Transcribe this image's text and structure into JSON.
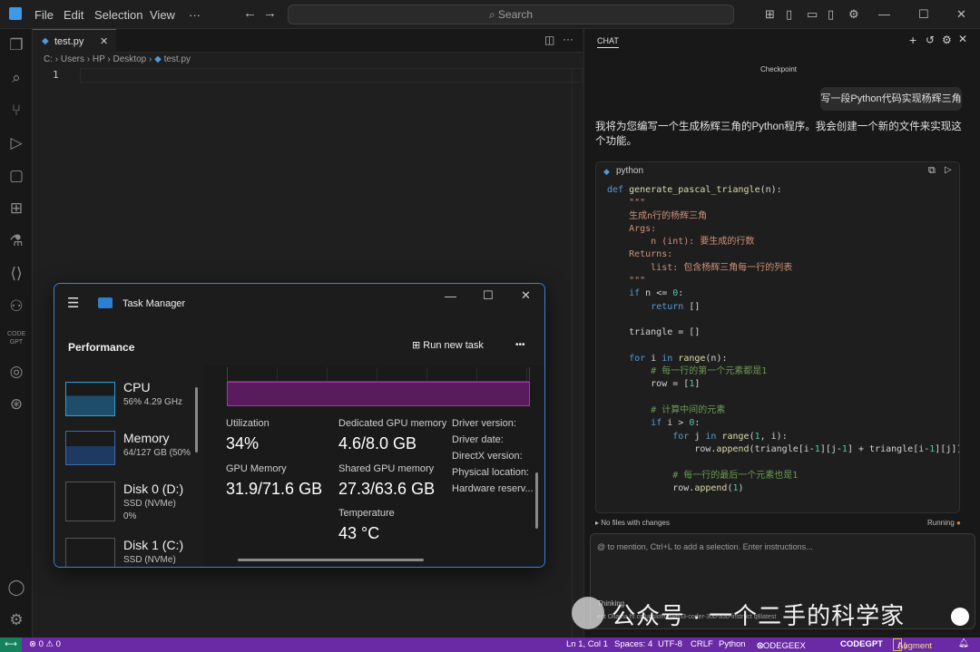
{
  "titlebar": {
    "menus": [
      "File",
      "Edit",
      "Selection",
      "View"
    ],
    "more": "···",
    "search_placeholder": "Search"
  },
  "editor": {
    "tab_name": "test.py",
    "breadcrumb": [
      "C:",
      "Users",
      "HP",
      "Desktop",
      "test.py"
    ],
    "line_number": "1"
  },
  "chat": {
    "title": "CHAT",
    "checkpoint": "Checkpoint",
    "user_message": "写一段Python代码实现杨辉三角",
    "ai_message": "我将为您编写一个生成杨辉三角的Python程序。我会创建一个新的文件来实现这个功能。",
    "code_lang": "python",
    "code_lines": [
      "def generate_pascal_triangle(n):",
      "    \"\"\"",
      "    生成n行的杨辉三角",
      "",
      "    Args:",
      "        n (int): 要生成的行数",
      "",
      "    Returns:",
      "        list: 包含杨辉三角每一行的列表",
      "    \"\"\"",
      "    if n <= 0:",
      "        return []",
      "",
      "    triangle = []",
      "",
      "    for i in range(n):",
      "        # 每一行的第一个元素都是1",
      "        row = [1]",
      "",
      "        # 计算中间的元素",
      "        if i > 0:",
      "            for j in range(1, i):",
      "                row.append(triangle[i-1][j-1] + triangle[i-1][j])",
      "",
      "            # 每一行的最后一个元素也是1",
      "            row.append(1)"
    ],
    "files_status": "No files with changes",
    "running": "Running",
    "input_placeholder": "@ to mention, Ctrl+L to add a selection. Enter instructions...",
    "thinking": "Thinking",
    "model": "ent  Ollama  hf.co/unsloth/qwen3-coder-30b-a3b-instruct  q8latest"
  },
  "taskmanager": {
    "title": "Task Manager",
    "section": "Performance",
    "run_new_task": "Run new task",
    "more": "•••",
    "sidebar": [
      {
        "name": "CPU",
        "sub": "56%  4.29 GHz"
      },
      {
        "name": "Memory",
        "sub": "64/127 GB (50%)"
      },
      {
        "name": "Disk 0 (D:)",
        "sub": "SSD (NVMe)",
        "sub2": "0%"
      },
      {
        "name": "Disk 1 (C:)",
        "sub": "SSD (NVMe)"
      }
    ],
    "stats": {
      "utilization_label": "Utilization",
      "utilization": "34%",
      "dedicated_label": "Dedicated GPU memory",
      "dedicated": "4.6/8.0 GB",
      "gpu_mem_label": "GPU Memory",
      "gpu_mem": "31.9/71.6 GB",
      "shared_label": "Shared GPU memory",
      "shared": "27.3/63.6 GB",
      "temp_label": "Temperature",
      "temp": "43 °C"
    },
    "info": [
      "Driver version:",
      "Driver date:",
      "DirectX version:",
      "Physical location:",
      "Hardware reserv..."
    ]
  },
  "statusbar": {
    "problems": "⊗ 0 ⚠ 0",
    "position": "Ln 1, Col 1",
    "spaces": "Spaces: 4",
    "encoding": "UTF-8",
    "eol": "CRLF",
    "language": "Python",
    "codegeex": "CODEGEEX",
    "codegpt": "CODEGPT",
    "augment": "Augment"
  },
  "watermark": "公众号 · 一个二手的科学家",
  "colors": {
    "accent": "#0078d4",
    "statusbar": "#6a2aa6",
    "gpu_graph": "#5a1a5e"
  }
}
